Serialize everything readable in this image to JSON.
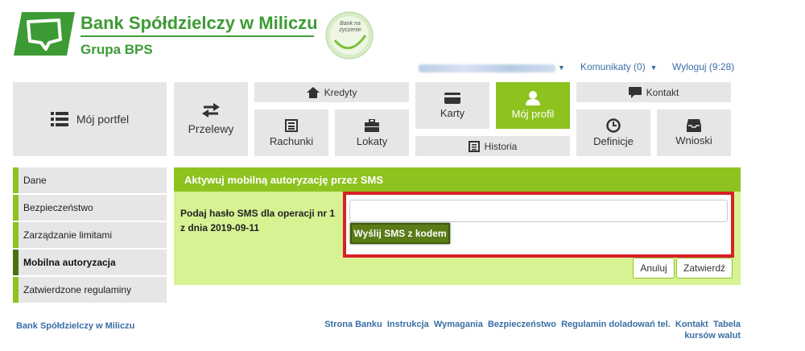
{
  "brand": {
    "title": "Bank Spółdzielczy w Miliczu",
    "subtitle": "Grupa BPS",
    "badge_text": "Bank na życzenie",
    "colors": {
      "primary": "#8dc21f",
      "dark": "#3d9b35",
      "alert": "#d91f26"
    }
  },
  "topbar": {
    "communicates": "Komunikaty (0)",
    "logout": "Wyloguj (9:28)"
  },
  "nav": {
    "portfolio": "Mój portfel",
    "transfers": "Przelewy",
    "credits": "Kredyty",
    "accounts": "Rachunki",
    "deposits": "Lokaty",
    "cards": "Karty",
    "history": "Historia",
    "profile": "Mój profil",
    "contact": "Kontakt",
    "definitions": "Definicje",
    "requests": "Wnioski"
  },
  "sidebar": {
    "items": [
      {
        "label": "Dane"
      },
      {
        "label": "Bezpieczeństwo"
      },
      {
        "label": "Zarządzanie limitami"
      },
      {
        "label": "Mobilna autoryzacja"
      },
      {
        "label": "Zatwierdzone regulaminy"
      }
    ]
  },
  "panel": {
    "title": "Aktywuj mobilną autoryzację przez SMS",
    "field_label": "Podaj hasło SMS dla operacji nr 1 z dnia 2019-09-11",
    "sms_value": "",
    "send_label": "Wyślij SMS z kodem",
    "cancel_label": "Anuluj",
    "confirm_label": "Zatwierdź"
  },
  "footer": {
    "bank_name": "Bank Spółdzielczy w Miliczu",
    "links": [
      "Strona Banku",
      "Instrukcja",
      "Wymagania",
      "Bezpieczeństwo",
      "Regulamin doladowań tel.",
      "Kontakt",
      "Tabela kursów walut"
    ]
  }
}
